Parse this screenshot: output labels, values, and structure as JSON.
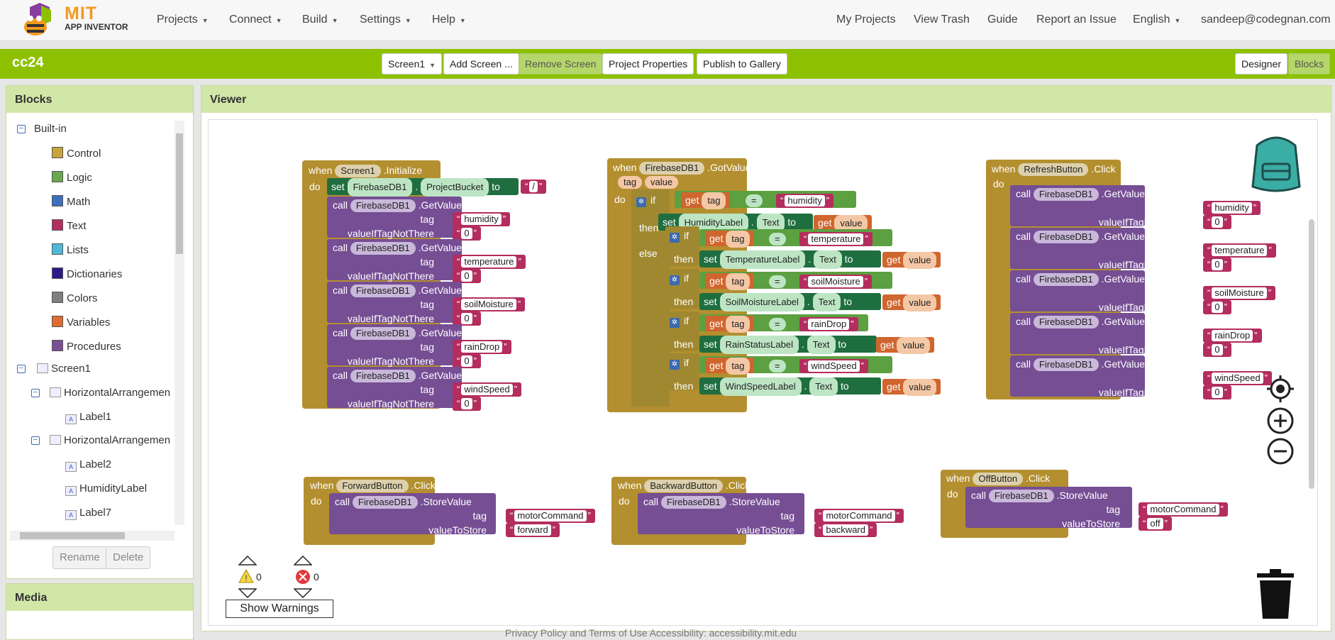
{
  "header": {
    "logo_title": "MIT",
    "logo_subtitle": "APP INVENTOR",
    "menus": [
      "Projects",
      "Connect",
      "Build",
      "Settings",
      "Help"
    ],
    "right_links": [
      "My Projects",
      "View Trash",
      "Guide",
      "Report an Issue"
    ],
    "language": "English",
    "user": "sandeep@codegnan.com"
  },
  "project": {
    "name": "cc24",
    "screen_select": "Screen1",
    "buttons": [
      "Add Screen ...",
      "Remove Screen",
      "Project Properties",
      "Publish to Gallery"
    ],
    "designer": "Designer",
    "blocks": "Blocks"
  },
  "blocks_panel": {
    "title": "Blocks",
    "builtin": "Built-in",
    "builtins": [
      {
        "label": "Control",
        "color": "#c9a43a"
      },
      {
        "label": "Logic",
        "color": "#6aa84f"
      },
      {
        "label": "Math",
        "color": "#3d6fbf"
      },
      {
        "label": "Text",
        "color": "#b32d5e"
      },
      {
        "label": "Lists",
        "color": "#4fb8d8"
      },
      {
        "label": "Dictionaries",
        "color": "#2b1b8a"
      },
      {
        "label": "Colors",
        "color": "#7f7f7f"
      },
      {
        "label": "Variables",
        "color": "#e06b2f"
      },
      {
        "label": "Procedures",
        "color": "#7a4f96"
      }
    ],
    "components": [
      "Screen1",
      "HorizontalArrangemen",
      "Label1",
      "HorizontalArrangemen",
      "Label2",
      "HumidityLabel",
      "Label7"
    ],
    "rename": "Rename",
    "delete": "Delete"
  },
  "media": {
    "title": "Media"
  },
  "viewer": {
    "title": "Viewer",
    "warnings_count": "0",
    "errors_count": "0",
    "show_warnings": "Show Warnings"
  },
  "kw": {
    "when": "when",
    "do": "do",
    "set": "set",
    "to": "to",
    "call": "call",
    "tag": "tag",
    "vitnt": "valueIfTagNotThere",
    "vts": "valueToStore",
    "if": "if",
    "then": "then",
    "else": "else",
    "get": "get",
    "value": "value",
    "eq": "=",
    "text": "Text",
    "initialize": ".Initialize",
    "getvalue": ".GetValue",
    "storevalue": ".StoreValue",
    "gotvalue": ".GotValue",
    "click": ".Click",
    "db": "FirebaseDB1",
    "bucket": "ProjectBucket",
    "slash": "/",
    "zero": "0"
  },
  "init_tags": [
    "humidity",
    "temperature",
    "soilMoisture",
    "rainDrop",
    "windSpeed"
  ],
  "gotvalue_rows": [
    {
      "tag": "humidity",
      "label": "HumidityLabel"
    },
    {
      "tag": "temperature",
      "label": "TemperatureLabel"
    },
    {
      "tag": "soilMoisture",
      "label": "SoilMoistureLabel"
    },
    {
      "tag": "rainDrop",
      "label": "RainStatusLabel"
    },
    {
      "tag": "windSpeed",
      "label": "WindSpeedLabel"
    }
  ],
  "components_ev": {
    "screen": "Screen1",
    "refresh": "RefreshButton",
    "forward": "ForwardButton",
    "backward": "BackwardButton",
    "off": "OffButton"
  },
  "store": {
    "tag": "motorCommand",
    "forward": "forward",
    "backward": "backward",
    "off": "off"
  },
  "footer": "Privacy Policy and Terms of Use     Accessibility: accessibility.mit.edu"
}
